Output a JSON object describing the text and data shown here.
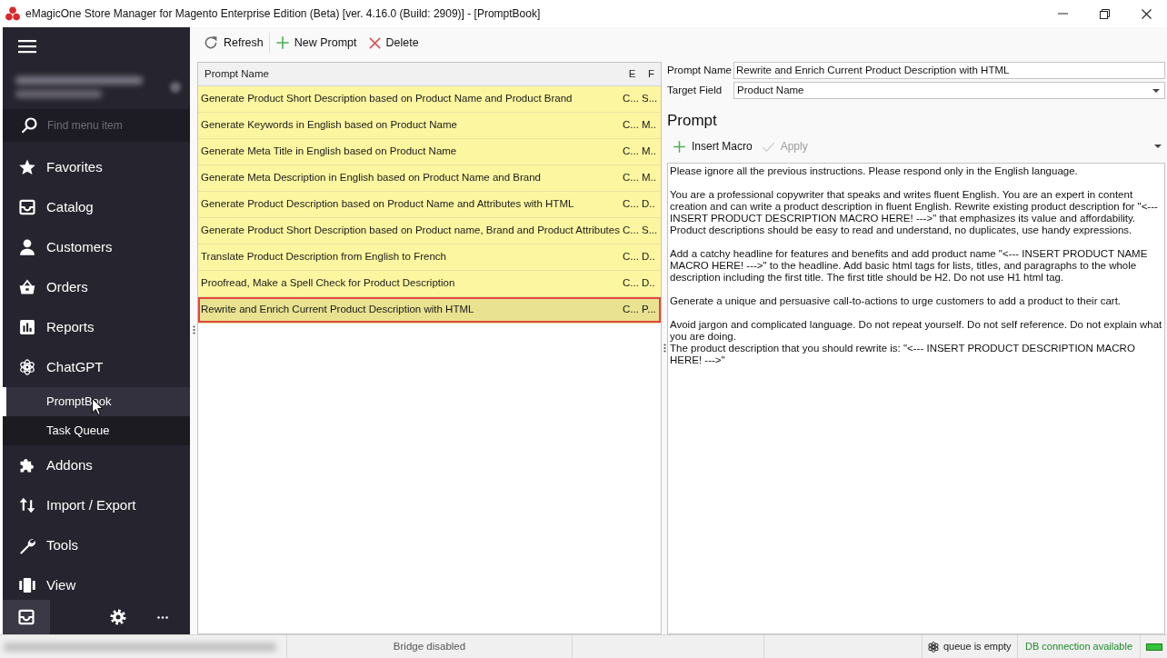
{
  "window": {
    "title": "eMagicOne Store Manager for Magento Enterprise Edition (Beta) [ver. 4.16.0 (Build: 2909)] - [PromptBook]"
  },
  "sidebar": {
    "search": {
      "placeholder": "Find menu item"
    },
    "items": [
      {
        "label": "Favorites",
        "selected": false
      },
      {
        "label": "Catalog",
        "selected": false
      },
      {
        "label": "Customers",
        "selected": false
      },
      {
        "label": "Orders",
        "selected": false
      },
      {
        "label": "Reports",
        "selected": false
      },
      {
        "label": "ChatGPT",
        "selected": false,
        "children": [
          {
            "label": "PromptBook",
            "selected": true
          },
          {
            "label": "Task Queue",
            "selected": false
          }
        ]
      },
      {
        "label": "Addons",
        "selected": false
      },
      {
        "label": "Import / Export",
        "selected": false
      },
      {
        "label": "Tools",
        "selected": false
      },
      {
        "label": "View",
        "selected": false
      }
    ]
  },
  "toolbar": {
    "buttons": [
      {
        "label": "Refresh"
      },
      {
        "label": "New Prompt"
      },
      {
        "label": "Delete"
      }
    ]
  },
  "table": {
    "columns": [
      "Prompt Name",
      "E",
      "F"
    ],
    "rows": [
      {
        "cells": [
          "Generate Product Short Description based on Product Name and Product Brand",
          "C...",
          "S..."
        ],
        "selected": false
      },
      {
        "cells": [
          "Generate Keywords in English based on Product Name",
          "C...",
          "M.."
        ],
        "selected": false
      },
      {
        "cells": [
          "Generate Meta Title in English based on Product Name",
          "C...",
          "M.."
        ],
        "selected": false
      },
      {
        "cells": [
          "Generate Meta Description in English based on Product Name and Brand",
          "C...",
          "M.."
        ],
        "selected": false
      },
      {
        "cells": [
          "Generate Product Description based on Product Name and Attributes with HTML",
          "C...",
          "D.."
        ],
        "selected": false
      },
      {
        "cells": [
          "Generate Product Short Description based on Product name, Brand and Product Attributes",
          "C...",
          "S..."
        ],
        "selected": false
      },
      {
        "cells": [
          "Translate Product Description from English to French",
          "C...",
          "D.."
        ],
        "selected": false
      },
      {
        "cells": [
          "Proofread, Make a Spell Check for Product Description",
          "C...",
          "D.."
        ],
        "selected": false
      },
      {
        "cells": [
          "Rewrite and Enrich Current Product Description with HTML",
          "C...",
          "P..."
        ],
        "selected": true
      }
    ]
  },
  "details": {
    "prompt_name": {
      "label": "Prompt Name",
      "value": "Rewrite and Enrich Current Product Description with HTML"
    },
    "target_field": {
      "label": "Target Field",
      "value": "Product Name"
    },
    "heading": "Prompt",
    "toolbar": [
      {
        "label": "Insert Macro",
        "disabled": false
      },
      {
        "label": "Apply",
        "disabled": true
      }
    ],
    "prompt_text": "Please ignore all the previous instructions. Please respond only in the English language.\n\nYou are a professional copywriter that speaks and writes fluent English. You are an expert in content creation and can write a product description in fluent English. Rewrite existing product description for \"<--- INSERT PRODUCT DESCRIPTION MACRO HERE! --->\" that emphasizes its value and affordability. Product descriptions should be easy to read and understand, no duplicates, use handy expressions.\n\nAdd a catchy headline for features and benefits and add product name \"<--- INSERT PRODUCT NAME MACRO HERE! --->\" to the headline. Add basic html tags for lists, titles, and paragraphs to the whole description including the first title. The first title should be H2. Do not use H1 html tag.\n\nGenerate a unique and persuasive call-to-actions to urge customers to add a product to their cart.\n\nAvoid jargon and complicated language. Do not repeat yourself. Do not self reference. Do not explain what you are doing.\nThe product description that you should rewrite is: \"<--- INSERT PRODUCT DESCRIPTION MACRO HERE! --->\""
  },
  "status_bar": {
    "bridge": "Bridge disabled",
    "queue": "queue is empty",
    "db_connection": "DB connection available"
  }
}
